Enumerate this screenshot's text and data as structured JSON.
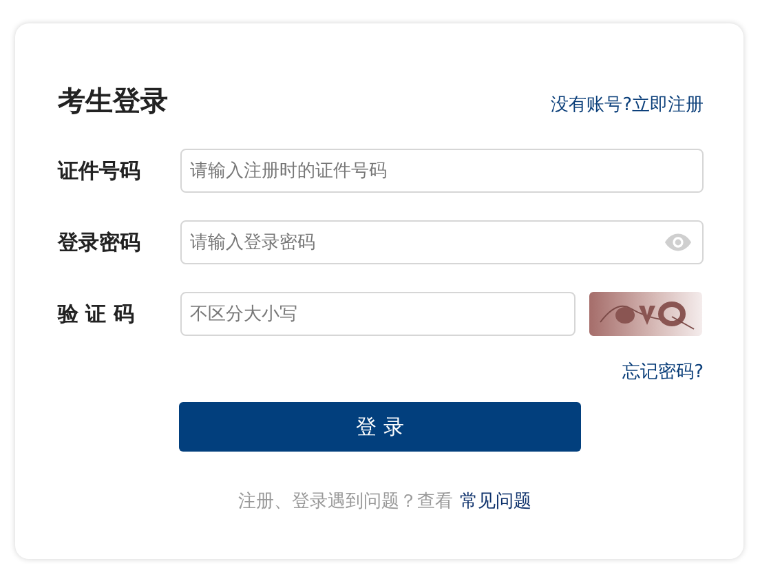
{
  "title": "考生登录",
  "register_link": "没有账号?立即注册",
  "fields": [
    {
      "kind": "text",
      "label": "证件号码",
      "placeholder": "请输入注册时的证件号码"
    },
    {
      "kind": "password",
      "label": "登录密码",
      "placeholder": "请输入登录密码"
    },
    {
      "kind": "captcha",
      "label": "验 证 码",
      "placeholder": "不区分大小写"
    }
  ],
  "forgot_link": "忘记密码?",
  "login_button": "登 录",
  "help": {
    "text": "注册、登录遇到问题？查看",
    "link": "常见问题"
  }
}
